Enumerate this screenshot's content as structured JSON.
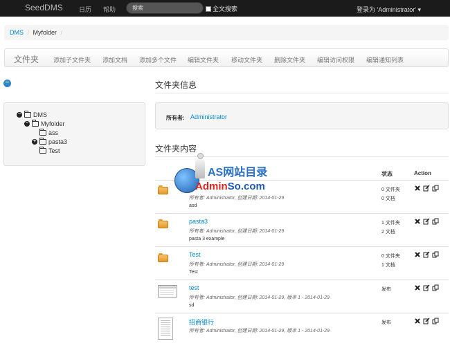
{
  "navbar": {
    "brand": "SeedDMS",
    "links": [
      "日历",
      "帮助"
    ],
    "search_placeholder": "搜索",
    "fulltext_label": "全文搜索",
    "user": "登录为 'Administrator'"
  },
  "breadcrumb": {
    "root": "DMS",
    "current": "Myfolder"
  },
  "actionbar": {
    "title": "文件夹",
    "actions": [
      "添加子文件夹",
      "添加文档",
      "添加多个文件",
      "编辑文件夹",
      "移动文件夹",
      "删除文件夹",
      "编辑访问权限",
      "编辑通知列表"
    ]
  },
  "tree": {
    "nodes": [
      {
        "label": "DMS",
        "toggle": "−"
      },
      {
        "label": "Myfolder",
        "toggle": "−"
      },
      {
        "label": "ass",
        "toggle": ""
      },
      {
        "label": "pasta3",
        "toggle": "+"
      },
      {
        "label": "Test",
        "toggle": ""
      }
    ]
  },
  "folder_info": {
    "title": "文件夹信息",
    "owner_label": "所有者:",
    "owner_value": "Administrator"
  },
  "folder_contents": {
    "title": "文件夹内容",
    "col_status": "状态",
    "col_action": "Action",
    "rows": [
      {
        "type": "folder",
        "name": "",
        "meta": "所有者: Administrator, 创建日期: 2014-01-29",
        "desc": "asd",
        "status1": "0 文件夹",
        "status2": "0 文档"
      },
      {
        "type": "folder",
        "name": "pasta3",
        "meta": "所有者: Administrator, 创建日期: 2014-01-29",
        "desc": "pasta 3 example",
        "status1": "1 文件夹",
        "status2": "2 文档"
      },
      {
        "type": "folder",
        "name": "Test",
        "meta": "所有者: Administrator, 创建日期: 2014-01-29",
        "desc": "Test",
        "status1": "0 文件夹",
        "status2": "1 文档"
      },
      {
        "type": "doc",
        "name": "test",
        "meta": "所有者: Administrator, 创建日期: 2014-01-29, 版本 1 - 2014-01-29",
        "desc": "sd",
        "status1": "发布",
        "status2": ""
      },
      {
        "type": "page",
        "name": "招商银行",
        "meta": "所有者: Administrator, 创建日期: 2014-01-29, 版本 1 - 2014-01-29",
        "desc": "",
        "status1": "发布",
        "status2": ""
      }
    ]
  },
  "watermark": {
    "line1": "AS网站目录",
    "line2_red": "Admin",
    "line2_blue": "So.com"
  }
}
